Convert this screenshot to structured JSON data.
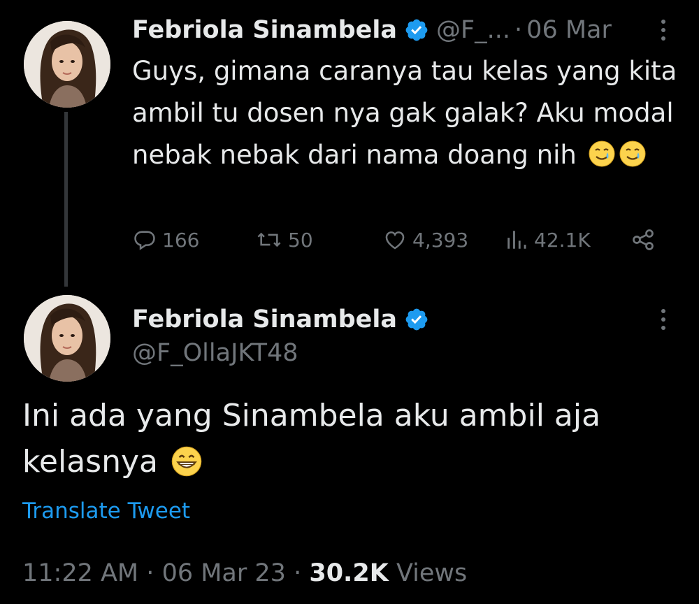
{
  "tweet1": {
    "author_name": "Febriola Sinambela",
    "handle_truncated": "@F_...",
    "separator": "·",
    "date": "06 Mar",
    "text": "Guys, gimana caranya tau kelas yang kita ambil tu dosen nya gak galak? Aku modal nebak nebak dari nama doang nih",
    "emojis": [
      "smiling-face-with-tear",
      "smiling-face-with-tear"
    ],
    "stats": {
      "replies": "166",
      "retweets": "50",
      "likes": "4,393",
      "views": "42.1K"
    }
  },
  "tweet2": {
    "author_name": "Febriola Sinambela",
    "handle": "@F_OllaJKT48",
    "text": "Ini ada yang Sinambela aku ambil aja kelasnya",
    "emoji": "grinning-face",
    "translate_label": "Translate Tweet",
    "time": "11:22 AM",
    "separator": "·",
    "date": "06 Mar 23",
    "views_count": "30.2K",
    "views_label": "Views"
  },
  "colors": {
    "background": "#000000",
    "text": "#e7e9ea",
    "secondary": "#71767b",
    "accent": "#1d9bf0",
    "verified": "#1d9bf0"
  },
  "icons": [
    "verified-badge-icon",
    "more-icon",
    "reply-icon",
    "retweet-icon",
    "like-icon",
    "views-icon",
    "share-icon"
  ]
}
